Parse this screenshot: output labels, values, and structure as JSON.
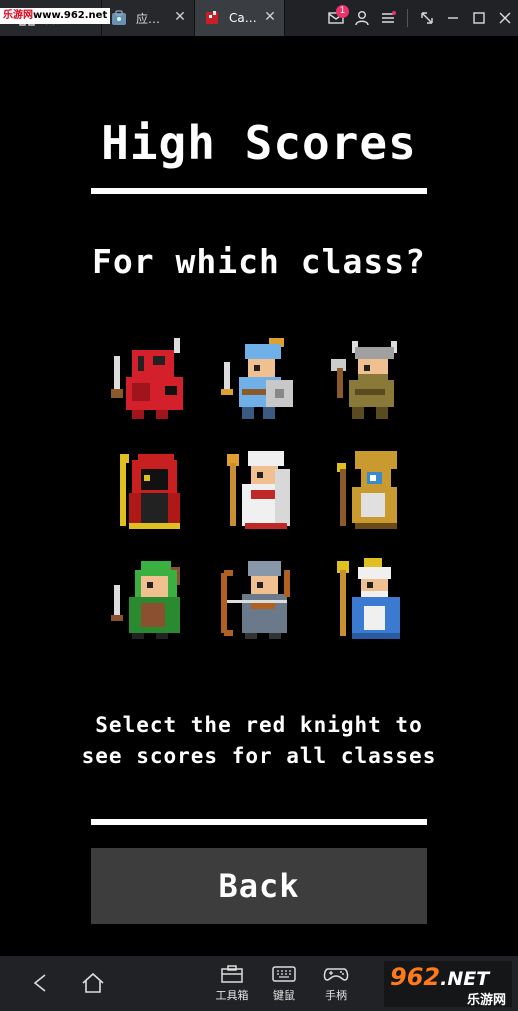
{
  "browser": {
    "watermark_brand": "乐游网",
    "watermark_url": "www.962.net",
    "tabs": [
      {
        "label": "首页",
        "icon": "home-icon"
      },
      {
        "label": "应…",
        "icon": "app-store-icon"
      },
      {
        "label": "Ca…",
        "icon": "game-icon"
      }
    ],
    "notification_count": "1"
  },
  "screen": {
    "title": "High Scores",
    "subtitle": "For which class?",
    "hint_line1": "Select the red knight to",
    "hint_line2": "see scores for all classes",
    "back_label": "Back"
  },
  "classes": [
    {
      "name": "red-knight",
      "colors": {
        "main": "#d4202a",
        "accent": "#c8c8c8"
      }
    },
    {
      "name": "blue-knight",
      "colors": {
        "main": "#6fb0e8",
        "accent": "#e0a030"
      }
    },
    {
      "name": "barbarian",
      "colors": {
        "main": "#8a7a3a",
        "accent": "#a0a0a0"
      }
    },
    {
      "name": "red-mage",
      "colors": {
        "main": "#c82020",
        "accent": "#e0c020"
      }
    },
    {
      "name": "white-cleric",
      "colors": {
        "main": "#f0f0f0",
        "accent": "#c02828"
      }
    },
    {
      "name": "golden-monk",
      "colors": {
        "main": "#c89a30",
        "accent": "#3a8ad0"
      }
    },
    {
      "name": "green-ranger",
      "colors": {
        "main": "#3ab040",
        "accent": "#8a5030"
      }
    },
    {
      "name": "grey-archer",
      "colors": {
        "main": "#8898a8",
        "accent": "#b06020"
      }
    },
    {
      "name": "blue-wizard",
      "colors": {
        "main": "#3a7ad0",
        "accent": "#f0f0f0"
      }
    }
  ],
  "bottom_bar": {
    "tools": [
      {
        "label": "工具箱",
        "icon": "toolbox-icon"
      },
      {
        "label": "键鼠",
        "icon": "keyboard-icon"
      },
      {
        "label": "手柄",
        "icon": "gamepad-icon"
      }
    ],
    "logo_text": "962",
    "logo_suffix": ".NET",
    "logo_brand": "乐游网"
  }
}
